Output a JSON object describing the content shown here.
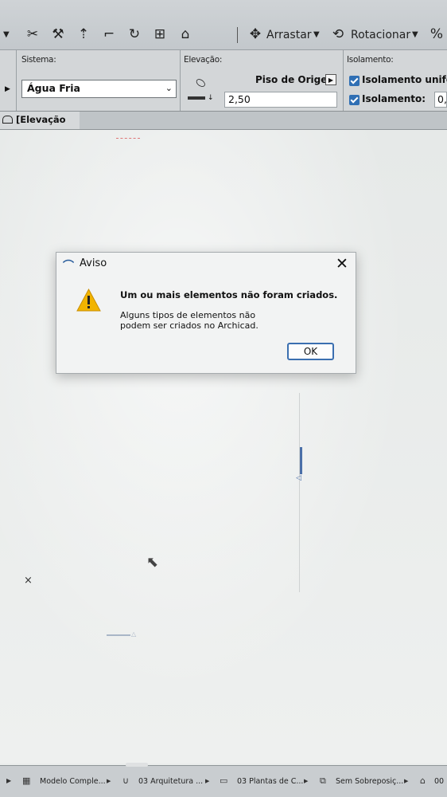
{
  "toolbar": {
    "drag_label": "Arrastar",
    "rotate_label": "Rotacionar"
  },
  "infobox": {
    "system_label": "Sistema:",
    "system_value": "Água Fria",
    "elevation_label": "Elevação:",
    "origin_label": "Piso de Origem",
    "elevation_value": "2,50",
    "insulation_label": "Isolamento:",
    "insulation_uniform_label": "Isolamento uniform",
    "insulation_value_label": "Isolamento:",
    "insulation_value": "0,"
  },
  "view": {
    "tab_label": "[Elevação Sul]"
  },
  "dialog": {
    "title": "Aviso",
    "heading": "Um ou mais elementos não foram criados.",
    "message": "Alguns tipos de elementos não podem ser criados no Archicad.",
    "ok_label": "OK"
  },
  "statusbar": {
    "items": [
      "Modelo Comple...",
      "03 Arquitetura ...",
      "03 Plantas de C...",
      "Sem Sobreposiç...",
      "00"
    ]
  }
}
